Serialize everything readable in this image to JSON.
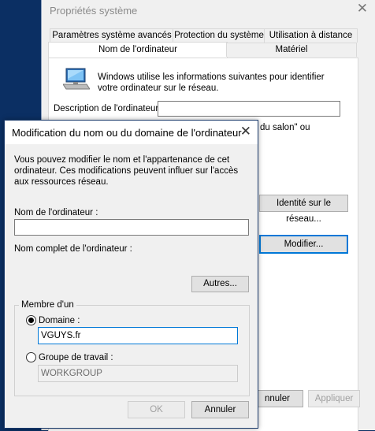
{
  "system_window": {
    "title": "Propriétés système",
    "tabs": [
      {
        "label": "Paramètres système avancés"
      },
      {
        "label": "Protection du système"
      },
      {
        "label": "Utilisation à distance"
      },
      {
        "label": "Nom de l'ordinateur"
      },
      {
        "label": "Matériel"
      }
    ],
    "intro_text": "Windows utilise les informations suivantes pour identifier votre ordinateur sur le réseau.",
    "description_label": "Description de l'ordinateur :",
    "description_value": "",
    "example_fragment": "du salon\" ou",
    "identity_button": "Identité sur le réseau...",
    "modify_button": "Modifier...",
    "cancel_fragment": "nnuler",
    "apply_button": "Appliquer"
  },
  "dialog": {
    "title": "Modification du nom ou du domaine de l'ordinateur",
    "intro_text": "Vous pouvez modifier le nom et l'appartenance de cet ordinateur. Ces modifications peuvent influer sur l'accès aux ressources réseau.",
    "computer_name_label": "Nom de l'ordinateur :",
    "computer_name_value": "",
    "full_name_label": "Nom complet de l'ordinateur :",
    "more_button": "Autres...",
    "member_of_label": "Membre d'un",
    "domain_label": "Domaine :",
    "domain_value": "VGUYS.fr",
    "domain_selected": true,
    "workgroup_label": "Groupe de travail :",
    "workgroup_value": "WORKGROUP",
    "ok_button": "OK",
    "cancel_button": "Annuler"
  },
  "colors": {
    "desktop": "#0b2f63",
    "accent": "#0078d7",
    "window_bg": "#f0f0f0"
  },
  "icons": {
    "computer": "monitor-icon",
    "close": "close-icon"
  }
}
